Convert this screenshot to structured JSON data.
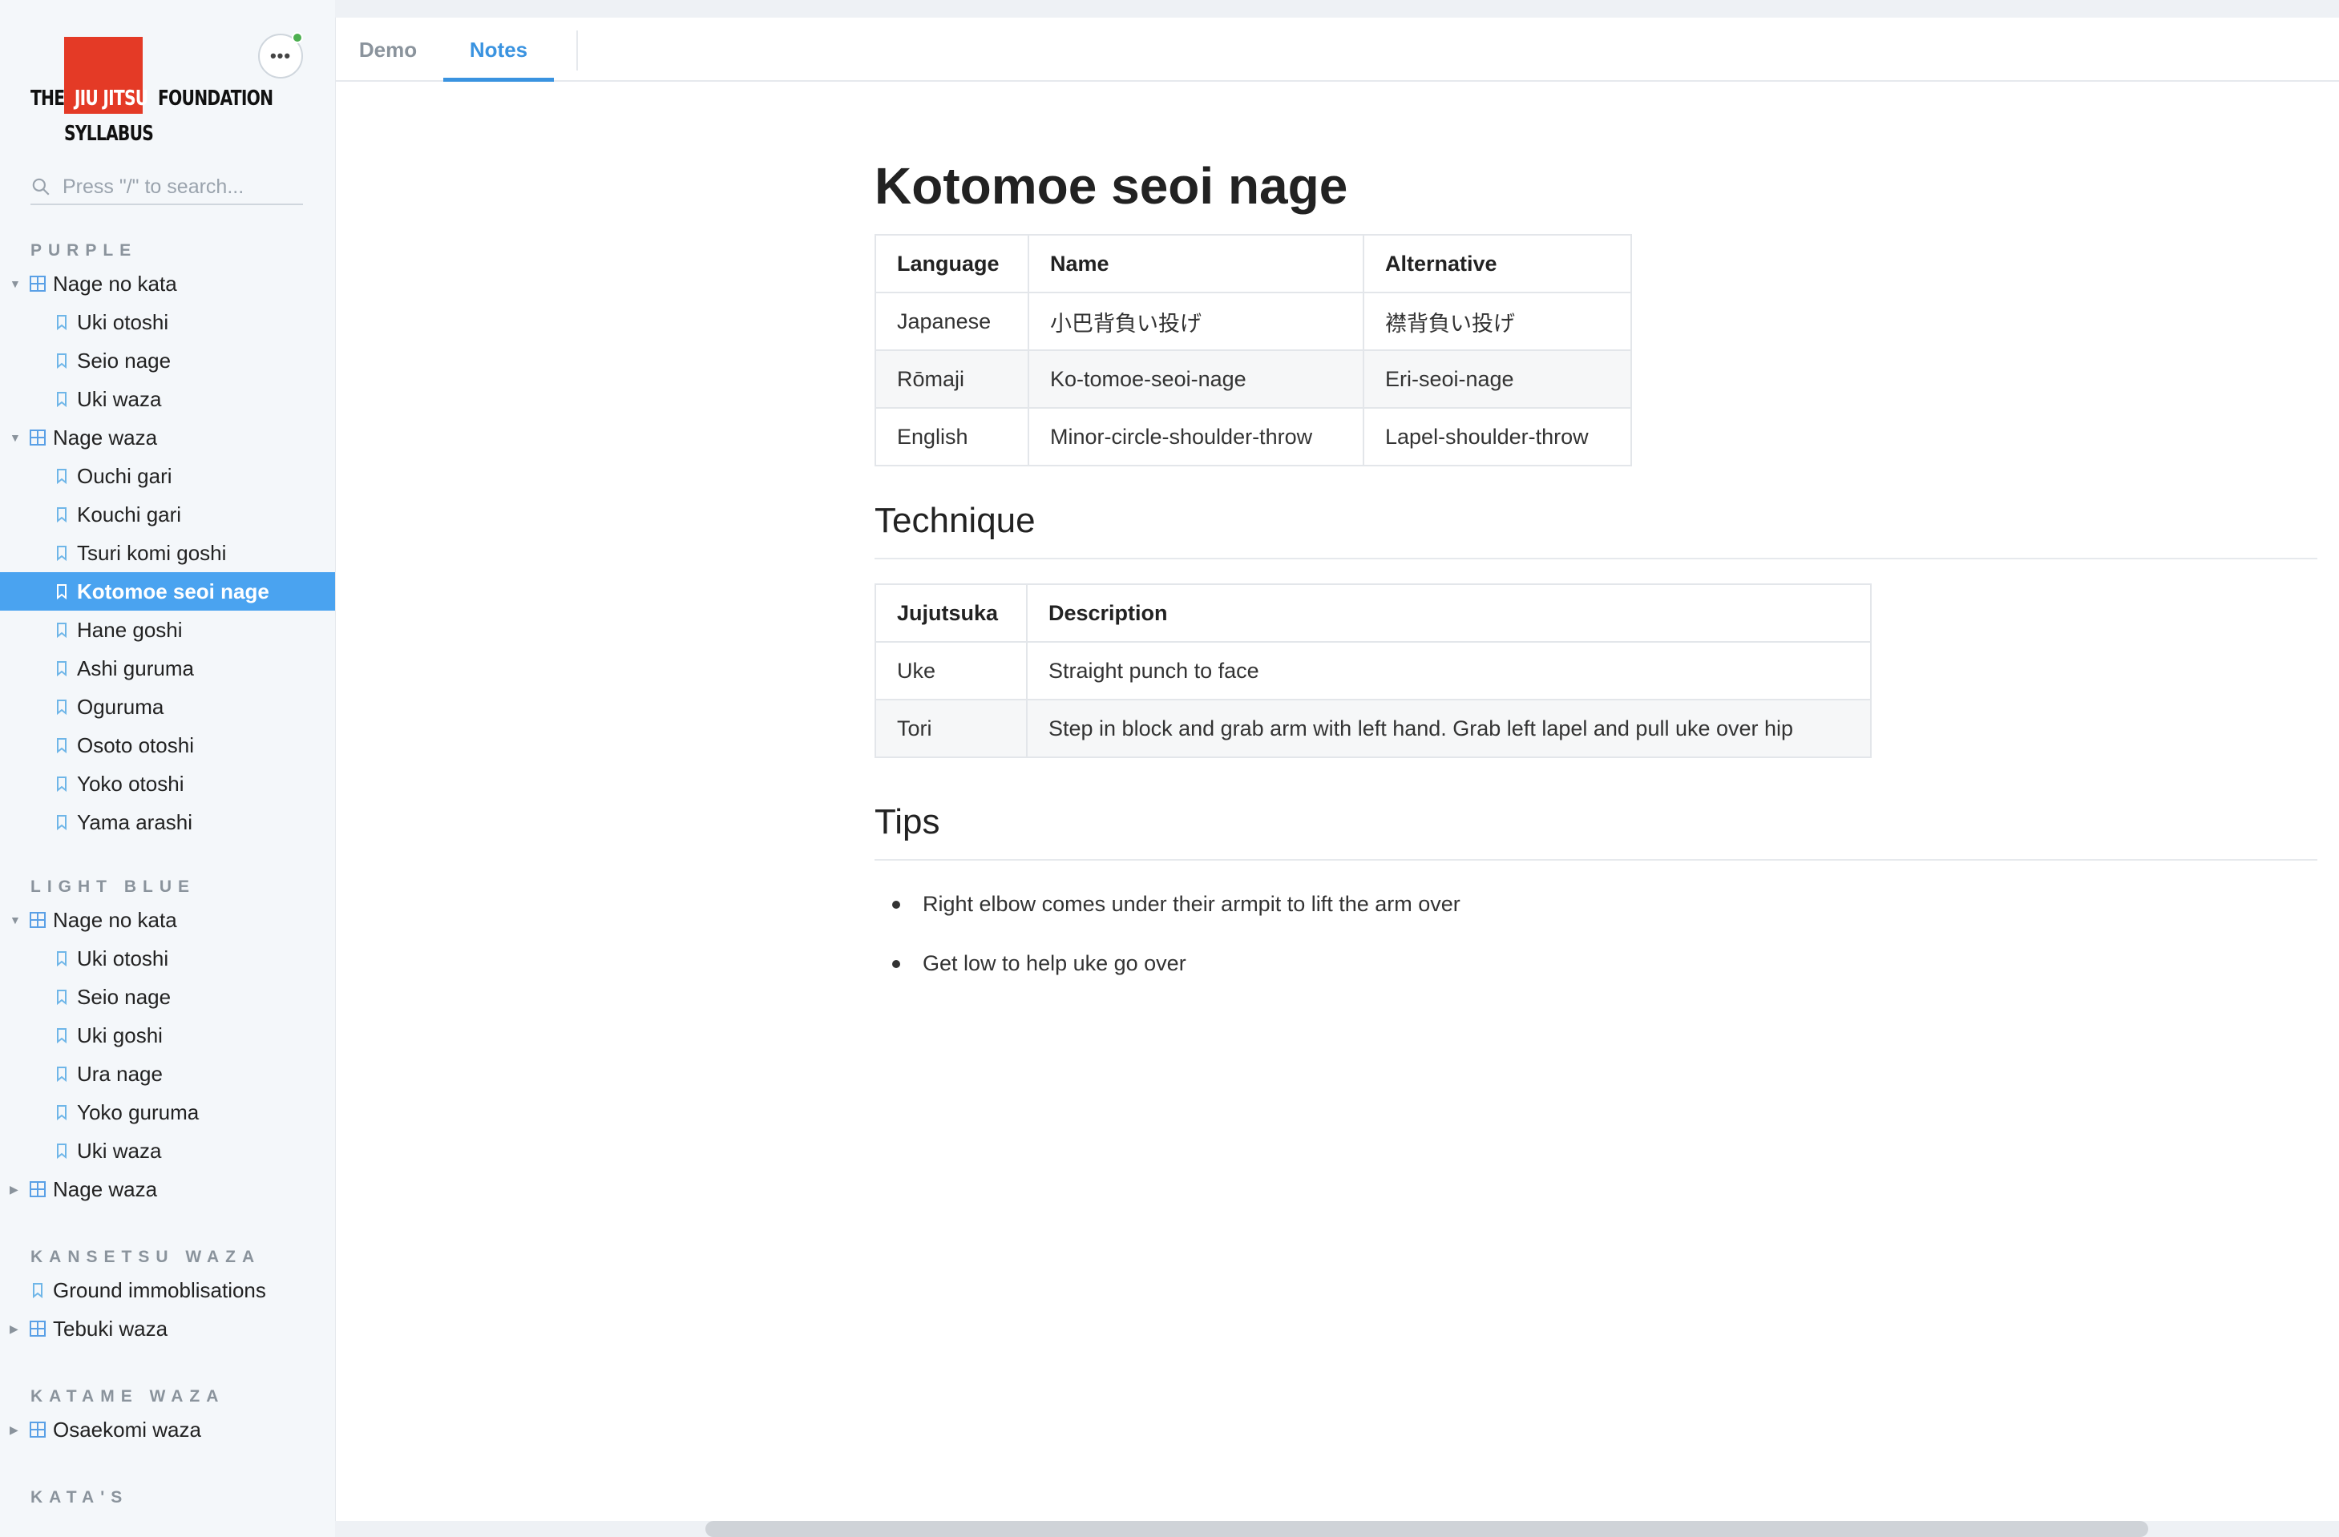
{
  "brand": {
    "word_the": "THE",
    "word_jiujitsu": "JIU JITSU",
    "word_foundation": "FOUNDATION",
    "word_syllabus": "SYLLABUS",
    "accent_color": "#e43a26"
  },
  "menu": {
    "label": "•••",
    "status_color": "#4caf50"
  },
  "search": {
    "placeholder": "Press \"/\" to search..."
  },
  "sidebar": {
    "purple": {
      "title": "PURPLE",
      "group1": {
        "label": "Nage no kata",
        "items": [
          "Uki otoshi",
          "Seio nage",
          "Uki waza"
        ]
      },
      "group2": {
        "label": "Nage waza",
        "items": [
          "Ouchi gari",
          "Kouchi gari",
          "Tsuri komi goshi",
          "Kotomoe seoi nage",
          "Hane goshi",
          "Ashi guruma",
          "Oguruma",
          "Osoto otoshi",
          "Yoko otoshi",
          "Yama arashi"
        ]
      }
    },
    "light_blue": {
      "title": "LIGHT BLUE",
      "group1": {
        "label": "Nage no kata",
        "items": [
          "Uki otoshi",
          "Seio nage",
          "Uki goshi",
          "Ura nage",
          "Yoko guruma",
          "Uki waza"
        ]
      },
      "group2": {
        "label": "Nage waza"
      }
    },
    "kansetsu": {
      "title": "KANSETSU WAZA",
      "leaf": "Ground immoblisations",
      "group": "Tebuki waza"
    },
    "katame": {
      "title": "KATAME WAZA",
      "group": "Osaekomi waza"
    },
    "katas": {
      "title": "KATA'S"
    },
    "active_color": "#4aa3f0"
  },
  "tabs": {
    "demo": "Demo",
    "notes": "Notes",
    "active_color": "#3a93e0"
  },
  "page": {
    "title": "Kotomoe seoi nage",
    "names": {
      "headers": [
        "Language",
        "Name",
        "Alternative"
      ],
      "rows": [
        [
          "Japanese",
          "小巴背負い投げ",
          "襟背負い投げ"
        ],
        [
          "Rōmaji",
          "Ko-tomoe-seoi-nage",
          "Eri-seoi-nage"
        ],
        [
          "English",
          "Minor-circle-shoulder-throw",
          "Lapel-shoulder-throw"
        ]
      ]
    },
    "technique": {
      "heading": "Technique",
      "headers": [
        "Jujutsuka",
        "Description"
      ],
      "rows": [
        [
          "Uke",
          "Straight punch to face"
        ],
        [
          "Tori",
          "Step in block and grab arm with left hand. Grab left lapel and pull uke over hip"
        ]
      ]
    },
    "tips": {
      "heading": "Tips",
      "items": [
        "Right elbow comes under their armpit to lift the arm over",
        "Get low to help uke go over"
      ]
    }
  }
}
